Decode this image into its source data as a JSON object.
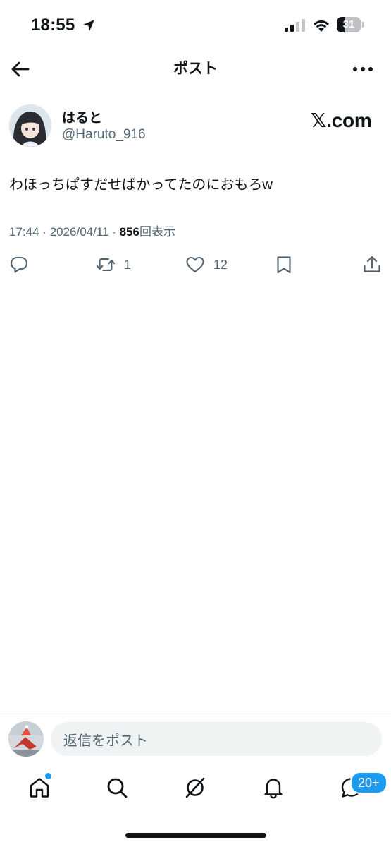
{
  "status_bar": {
    "time": "18:55",
    "battery": "31",
    "battery_level": 0.31
  },
  "header": {
    "title": "ポスト"
  },
  "post": {
    "author_name": "はると",
    "author_handle": "@Haruto_916",
    "source_logo": {
      "x": "𝕏",
      "domain": ".com"
    },
    "text": "わほっちぱすだせばかってたのにおもろw",
    "time": "17:44 · 2026/04/11 · ",
    "views": "856",
    "views_label": "回表示"
  },
  "actions": {
    "reply_count": "",
    "repost_count": "1",
    "like_count": "12"
  },
  "reply_bar": {
    "placeholder": "返信をポスト"
  },
  "nav": {
    "notifications_badge": "20+"
  },
  "colors": {
    "accent": "#1d9bf0",
    "text": "#0f1419",
    "secondary": "#536471"
  }
}
